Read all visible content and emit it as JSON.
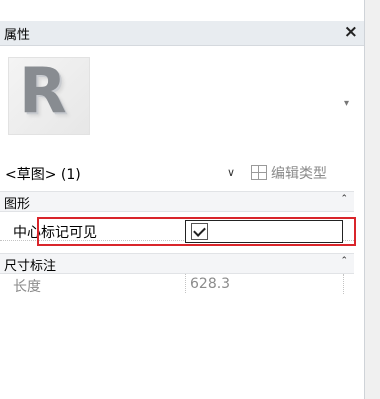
{
  "panel": {
    "title": "属性",
    "close_glyph": "×",
    "type_selector": {
      "logo_letter": "R",
      "dropdown_glyph": "▾"
    },
    "instance_selector": {
      "value": "<草图> (1)",
      "chevron_glyph": "∨",
      "edit_type_label": "编辑类型"
    },
    "groups": [
      {
        "title": "图形",
        "collapse_glyph": "⌃",
        "properties": [
          {
            "name": "中心标记可见",
            "value_type": "checkbox",
            "checked": true
          }
        ]
      },
      {
        "title": "尺寸标注",
        "collapse_glyph": "⌃",
        "properties": [
          {
            "name": "长度",
            "value": "628.3"
          }
        ]
      }
    ]
  },
  "colors": {
    "highlight": "#d9252b",
    "title_bar": "#e8ecf0",
    "muted_text": "#8b8b8b"
  },
  "icons": [
    "close-icon",
    "revit-logo",
    "chevron-down-icon",
    "edit-type-icon",
    "collapse-icon",
    "checkbox-checked"
  ]
}
